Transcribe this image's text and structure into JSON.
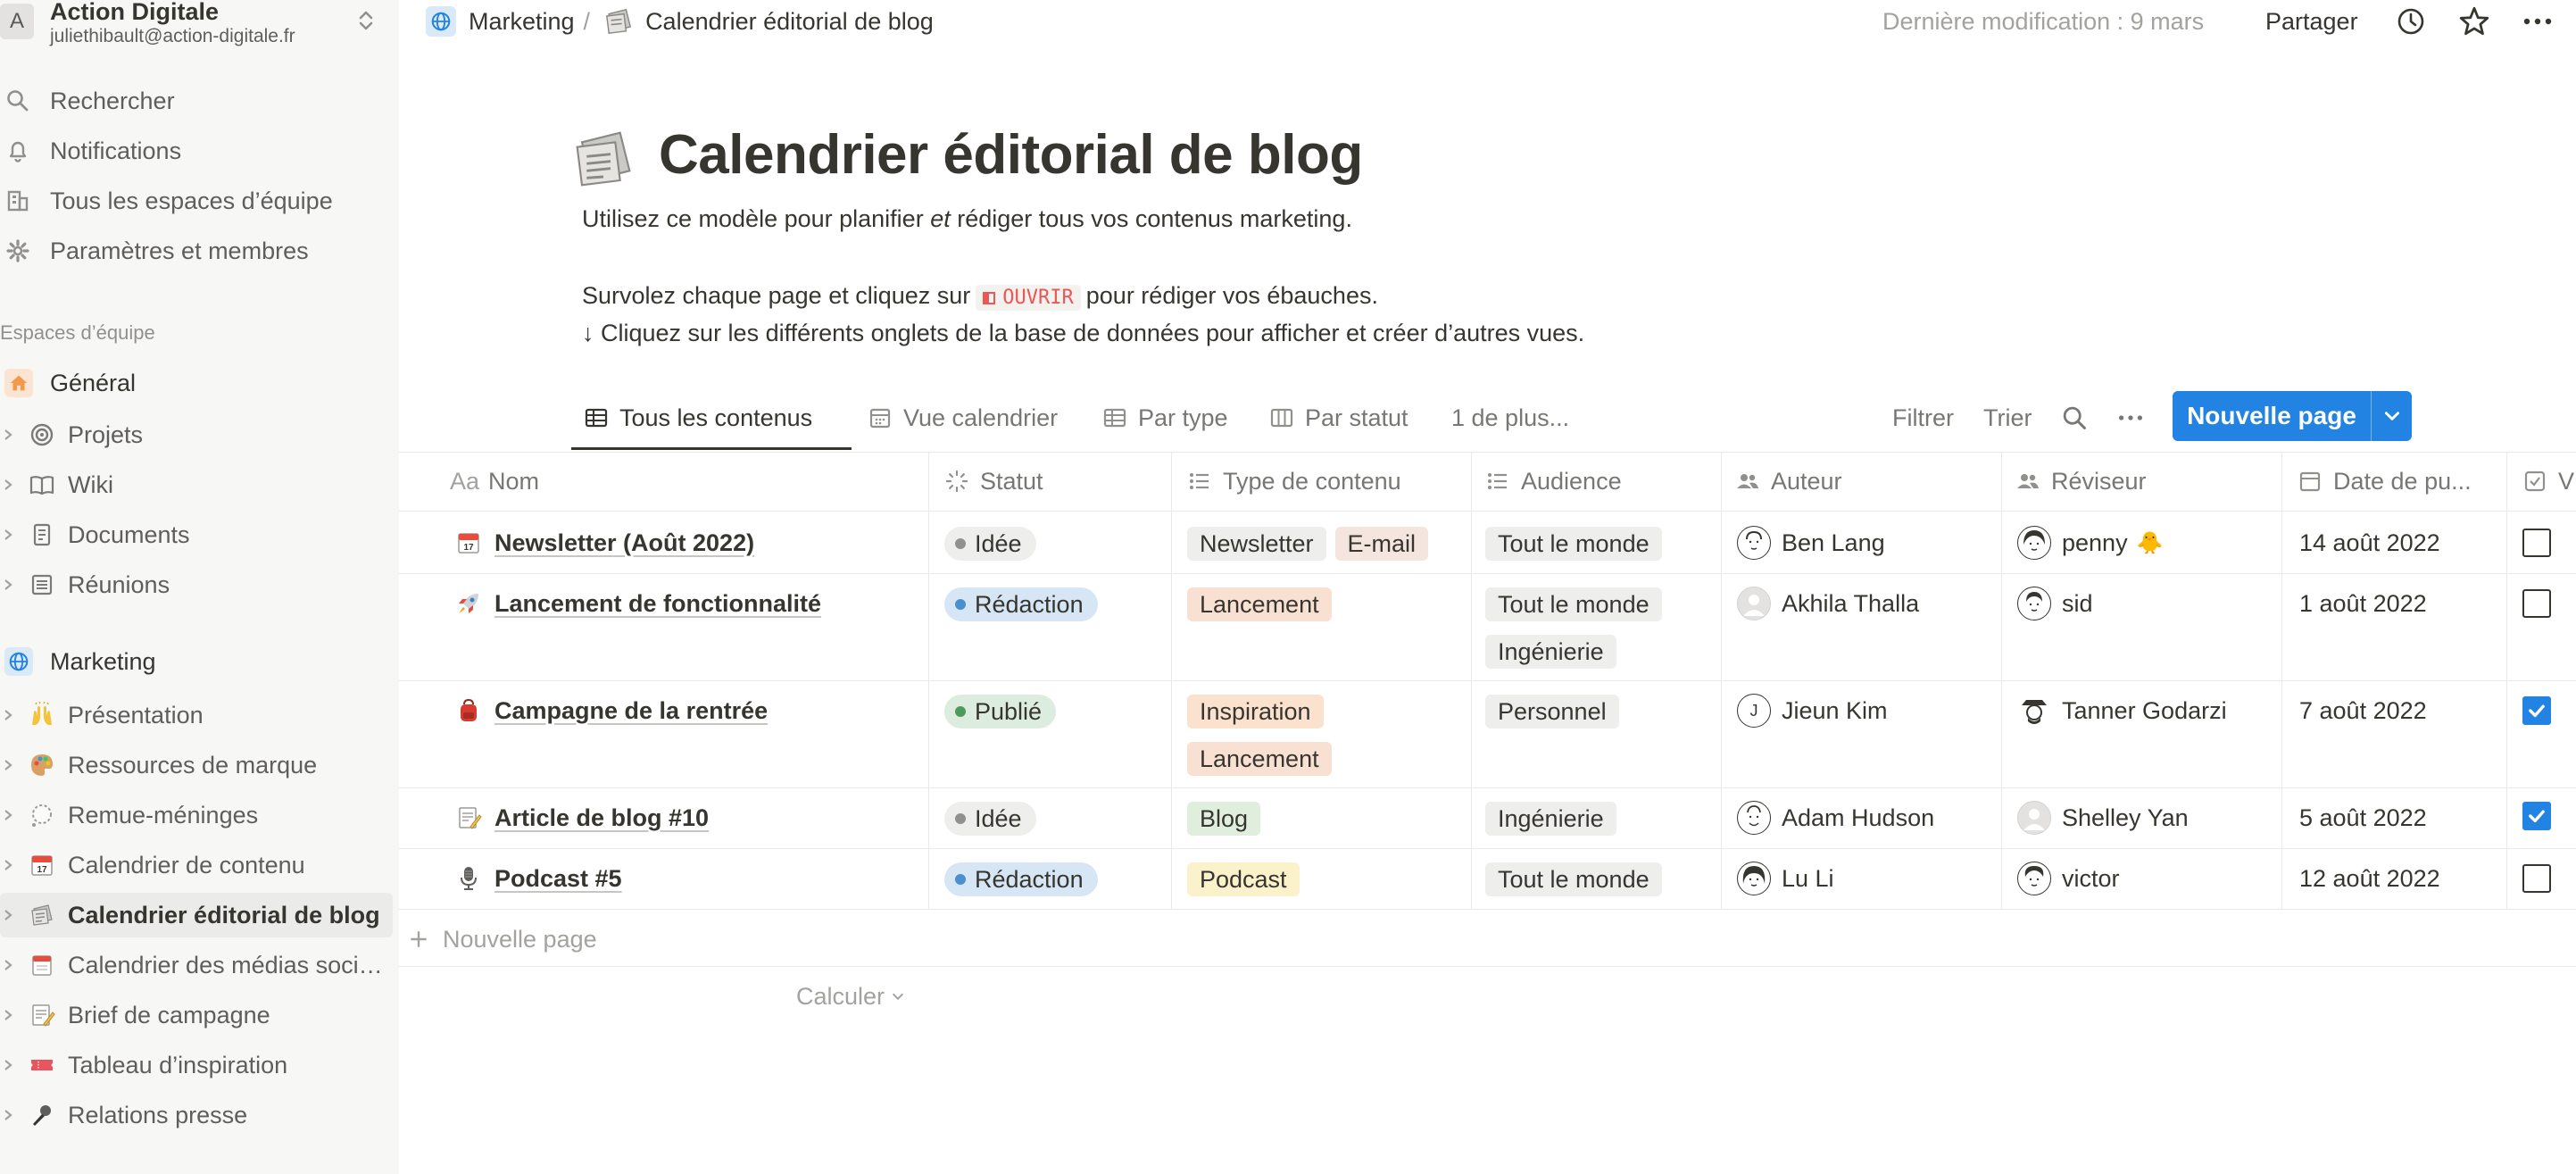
{
  "workspace": {
    "avatar_letter": "A",
    "name": "Action Digitale",
    "email": "juliethibault@action-digitale.fr"
  },
  "sidebar": {
    "top_items": [
      {
        "label": "Rechercher",
        "icon": "search-icon"
      },
      {
        "label": "Notifications",
        "icon": "bell-icon"
      },
      {
        "label": "Tous les espaces d’équipe",
        "icon": "building-icon"
      },
      {
        "label": "Paramètres et membres",
        "icon": "gear-icon"
      }
    ],
    "section_label": "Espaces d’équipe",
    "general": {
      "label": "Général",
      "icon": "home-icon",
      "color": "#f2994a"
    },
    "general_children": [
      {
        "label": "Projets",
        "icon": "target-icon"
      },
      {
        "label": "Wiki",
        "icon": "book-icon"
      },
      {
        "label": "Documents",
        "icon": "document-icon"
      },
      {
        "label": "Réunions",
        "icon": "notes-icon"
      }
    ],
    "marketing": {
      "label": "Marketing",
      "icon": "globe-icon",
      "color": "#2383e2"
    },
    "marketing_children": [
      {
        "label": "Présentation",
        "icon": "raised-hands-icon"
      },
      {
        "label": "Ressources de marque",
        "icon": "palette-icon"
      },
      {
        "label": "Remue-méninges",
        "icon": "thought-bubble-icon"
      },
      {
        "label": "Calendrier de contenu",
        "icon": "calendar-icon"
      },
      {
        "label": "Calendrier éditorial de blog",
        "icon": "newspaper-icon",
        "active": true
      },
      {
        "label": "Calendrier des médias sociaux",
        "icon": "tear-off-calendar-icon"
      },
      {
        "label": "Brief de campagne",
        "icon": "memo-icon"
      },
      {
        "label": "Tableau d’inspiration",
        "icon": "ticket-icon"
      },
      {
        "label": "Relations presse",
        "icon": "microphone-icon"
      }
    ]
  },
  "topbar": {
    "breadcrumb": [
      {
        "label": "Marketing",
        "icon": "globe-icon"
      },
      {
        "label": "Calendrier éditorial de blog",
        "icon": "newspaper-icon"
      }
    ],
    "separator": "/",
    "last_modified": "Dernière modification : 9 mars",
    "share_label": "Partager",
    "icons": [
      "history-icon",
      "star-icon",
      "more-icon"
    ]
  },
  "page": {
    "icon": "newspaper-icon",
    "title": "Calendrier éditorial de blog",
    "desc1_a": "Utilisez ce modèle pour planifier ",
    "desc1_em": "et",
    "desc1_b": " rédiger tous vos contenus marketing.",
    "desc2_a": "Survolez chaque page et cliquez sur",
    "desc2_code": "OUVRIR",
    "desc2_b": "pour rédiger vos ébauches.",
    "desc3": "↓ Cliquez sur les différents onglets de la base de données pour afficher et créer d’autres vues."
  },
  "views": {
    "tabs": [
      {
        "label": "Tous les contenus",
        "icon": "table-icon",
        "active": true
      },
      {
        "label": "Vue calendrier",
        "icon": "calendar-view-icon"
      },
      {
        "label": "Par type",
        "icon": "table-icon"
      },
      {
        "label": "Par statut",
        "icon": "board-icon"
      }
    ],
    "more_label": "1 de plus...",
    "filter_label": "Filtrer",
    "sort_label": "Trier",
    "new_page_label": "Nouvelle page"
  },
  "table": {
    "columns": [
      {
        "label": "Nom",
        "icon": "text-property-icon"
      },
      {
        "label": "Statut",
        "icon": "status-property-icon"
      },
      {
        "label": "Type de contenu",
        "icon": "multiselect-property-icon"
      },
      {
        "label": "Audience",
        "icon": "multiselect-property-icon"
      },
      {
        "label": "Auteur",
        "icon": "person-property-icon"
      },
      {
        "label": "Réviseur",
        "icon": "person-property-icon"
      },
      {
        "label": "Date de pu...",
        "icon": "date-property-icon"
      },
      {
        "label": "V",
        "icon": "checkbox-property-icon"
      }
    ],
    "text_property_prefix": "Aa",
    "rows": [
      {
        "icon": "calendar-icon",
        "name": "Newsletter (Août 2022)",
        "status": "Idée",
        "status_color": "grey",
        "types": [
          "Newsletter",
          "E-mail"
        ],
        "audience": [
          "Tout le monde"
        ],
        "author": "Ben Lang",
        "reviewer": "penny",
        "reviewer_extra": "🐥",
        "date": "14 août 2022",
        "checked": false
      },
      {
        "icon": "rocket-icon",
        "name": "Lancement de fonctionnalité",
        "status": "Rédaction",
        "status_color": "blue",
        "types": [
          "Lancement"
        ],
        "audience": [
          "Tout le monde",
          "Ingénierie"
        ],
        "author": "Akhila Thalla",
        "reviewer": "sid",
        "date": "1 août 2022",
        "checked": false
      },
      {
        "icon": "backpack-icon",
        "name": "Campagne de la rentrée",
        "status": "Publié",
        "status_color": "green",
        "types": [
          "Inspiration",
          "Lancement"
        ],
        "audience": [
          "Personnel"
        ],
        "author": "Jieun Kim",
        "author_initial": "J",
        "reviewer": "Tanner Godarzi",
        "date": "7 août 2022",
        "checked": true
      },
      {
        "icon": "memo-icon",
        "name": "Article de blog #10",
        "status": "Idée",
        "status_color": "grey",
        "types": [
          "Blog"
        ],
        "audience": [
          "Ingénierie"
        ],
        "author": "Adam Hudson",
        "reviewer": "Shelley Yan",
        "date": "5 août 2022",
        "checked": true
      },
      {
        "icon": "microphone-icon",
        "name": "Podcast #5",
        "status": "Rédaction",
        "status_color": "blue",
        "types": [
          "Podcast"
        ],
        "audience": [
          "Tout le monde"
        ],
        "author": "Lu Li",
        "reviewer": "victor",
        "date": "12 août 2022",
        "checked": false
      }
    ],
    "new_row_label": "Nouvelle page",
    "calculate_label": "Calculer"
  },
  "colors": {
    "accent": "#2383e2",
    "tag_newsletter": "#eeeeec",
    "tag_email": "#f4e6de",
    "tag_lancement": "#f8e1d3",
    "tag_inspiration": "#fbe2cf",
    "tag_blog": "#dfeedd",
    "tag_podcast": "#fbf1cb",
    "tag_audience": "#eeeeec",
    "status_grey": "#eeeeec",
    "status_blue": "#d6e6f4",
    "status_green": "#dcecdf"
  }
}
